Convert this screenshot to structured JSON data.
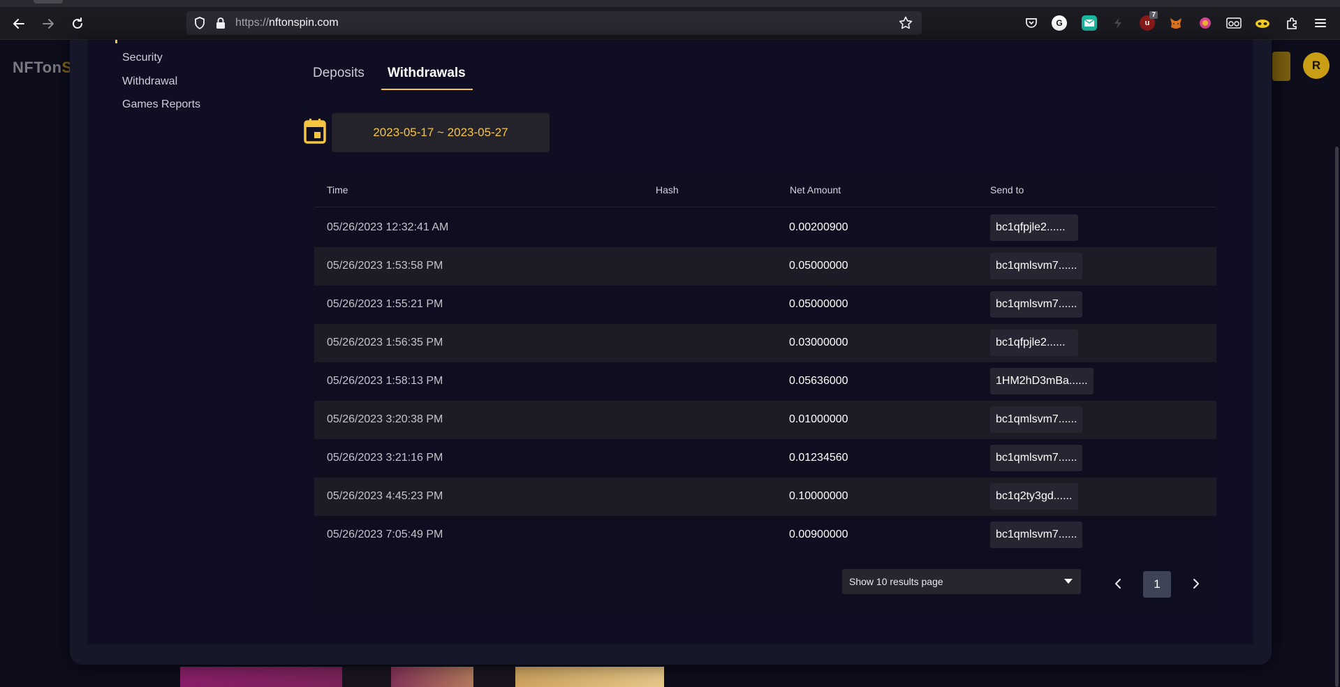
{
  "browser": {
    "url_scheme": "https://",
    "url_host": "nftonspin.com",
    "ext_badge": "7",
    "ext_g_label": "G"
  },
  "site": {
    "logo_main": "NFTon",
    "logo_accent": "S",
    "avatar_initial": "R"
  },
  "sidebar": {
    "items": [
      {
        "label": "Security"
      },
      {
        "label": "Withdrawal"
      },
      {
        "label": "Games Reports"
      }
    ]
  },
  "tabs": [
    {
      "label": "Deposits"
    },
    {
      "label": "Withdrawals"
    }
  ],
  "date_range": "2023-05-17 ~ 2023-05-27",
  "table": {
    "headers": {
      "time": "Time",
      "hash": "Hash",
      "net_amount": "Net Amount",
      "send_to": "Send to"
    },
    "rows": [
      {
        "time": "05/26/2023 12:32:41 AM",
        "hash": "",
        "amount": "0.00200900",
        "send_to": "bc1qfpjle2......"
      },
      {
        "time": "05/26/2023 1:53:58 PM",
        "hash": "",
        "amount": "0.05000000",
        "send_to": "bc1qmlsvm7......"
      },
      {
        "time": "05/26/2023 1:55:21 PM",
        "hash": "",
        "amount": "0.05000000",
        "send_to": "bc1qmlsvm7......"
      },
      {
        "time": "05/26/2023 1:56:35 PM",
        "hash": "",
        "amount": "0.03000000",
        "send_to": "bc1qfpjle2......"
      },
      {
        "time": "05/26/2023 1:58:13 PM",
        "hash": "",
        "amount": "0.05636000",
        "send_to": "1HM2hD3mBa......"
      },
      {
        "time": "05/26/2023 3:20:38 PM",
        "hash": "",
        "amount": "0.01000000",
        "send_to": "bc1qmlsvm7......"
      },
      {
        "time": "05/26/2023 3:21:16 PM",
        "hash": "",
        "amount": "0.01234560",
        "send_to": "bc1qmlsvm7......"
      },
      {
        "time": "05/26/2023 4:45:23 PM",
        "hash": "",
        "amount": "0.10000000",
        "send_to": "bc1q2ty3gd......"
      },
      {
        "time": "05/26/2023 7:05:49 PM",
        "hash": "",
        "amount": "0.00900000",
        "send_to": "bc1qmlsvm7......"
      }
    ]
  },
  "pagination": {
    "page_size_label": "Show 10 results page",
    "current_page": "1"
  },
  "colors": {
    "accent": "#f5c542",
    "background": "#0f0e23",
    "row_alt": "#1c1c27"
  }
}
